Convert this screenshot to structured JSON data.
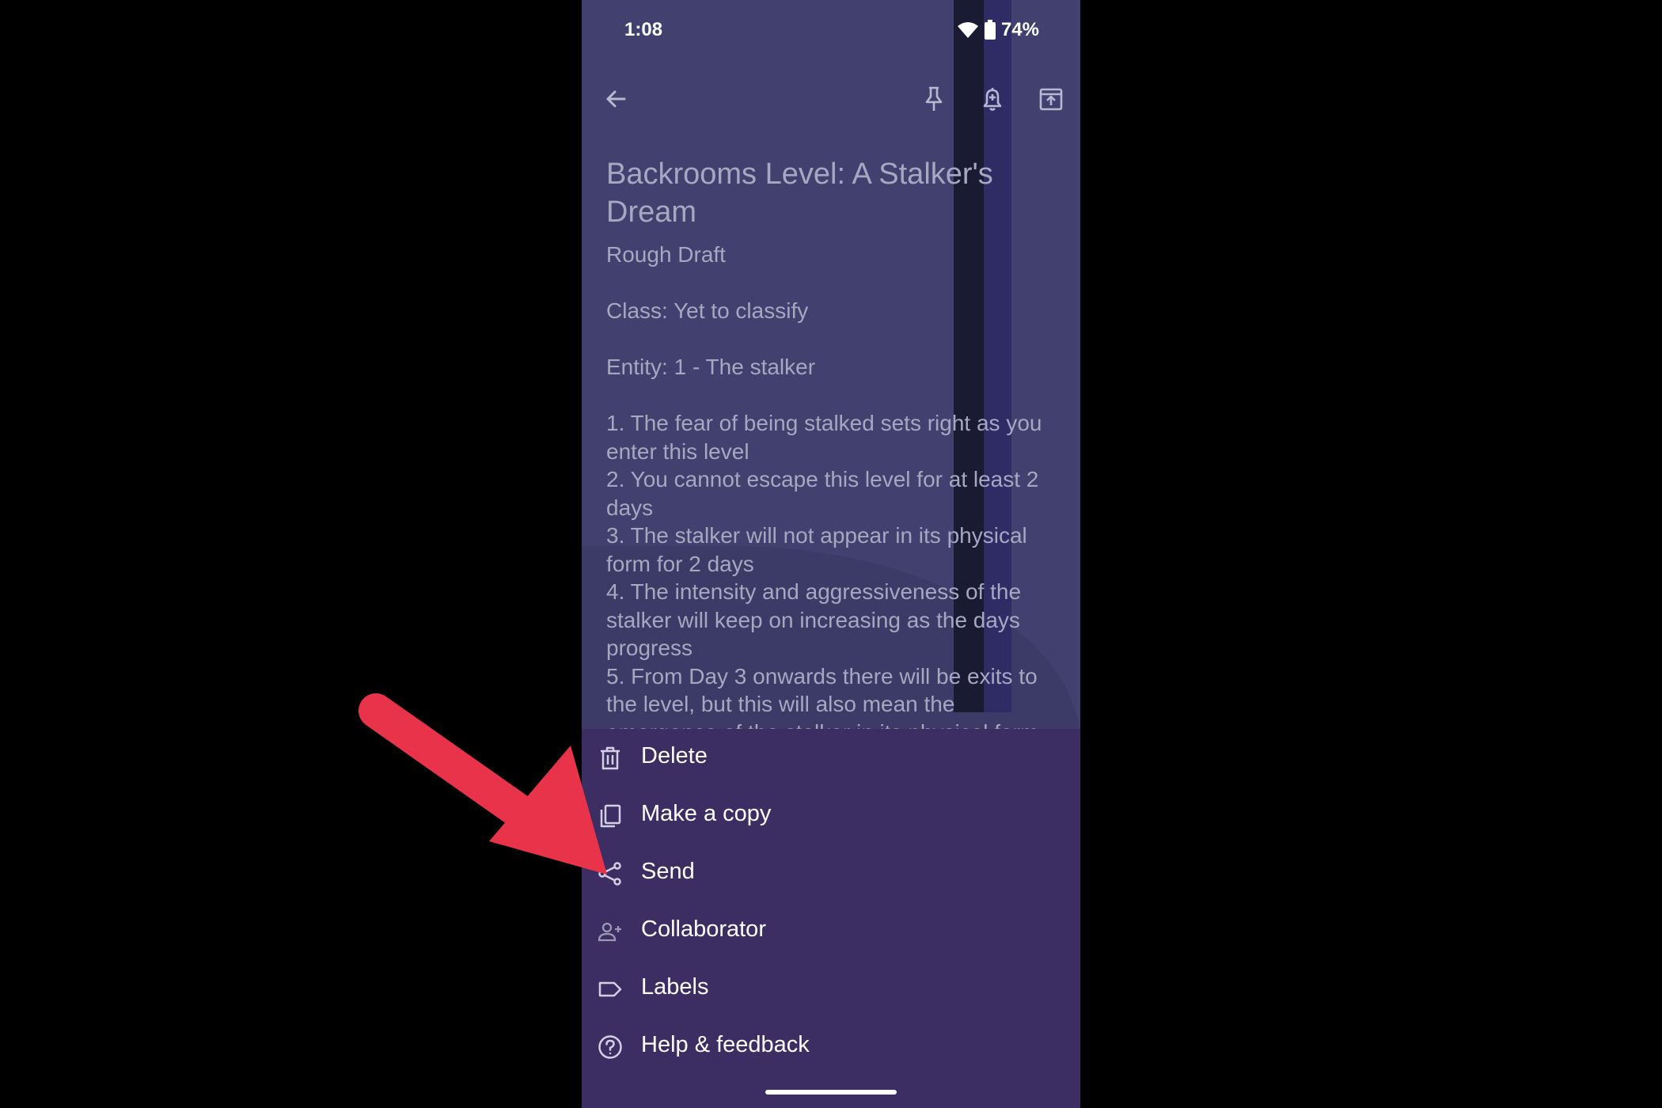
{
  "status_bar": {
    "time": "1:08",
    "battery": "74%"
  },
  "toolbar": {
    "back_icon": "arrow-back-icon",
    "pin_icon": "pin-icon",
    "reminder_icon": "add-alert-icon",
    "archive_icon": "archive-icon"
  },
  "note": {
    "title": "Backrooms Level: A Stalker's Dream",
    "body": "Rough Draft\n\nClass: Yet to classify\n\nEntity: 1 - The stalker\n\n1. The fear of being stalked sets right as you enter this level\n2. You cannot escape this level for at least 2 days\n3. The stalker will not appear in its physical form for 2 days\n4. The intensity and aggressiveness of the stalker will keep on increasing as the days progress\n5. From Day 3 onwards there will be exits to the level, but this will also mean the emergence of the stalker in its physical form"
  },
  "menu": {
    "items": [
      {
        "label": "Delete",
        "icon": "trash-icon"
      },
      {
        "label": "Make a copy",
        "icon": "copy-icon"
      },
      {
        "label": "Send",
        "icon": "share-icon"
      },
      {
        "label": "Collaborator",
        "icon": "add-person-icon"
      },
      {
        "label": "Labels",
        "icon": "label-icon"
      },
      {
        "label": "Help & feedback",
        "icon": "help-icon"
      }
    ]
  },
  "colors": {
    "note_background": "#41406f",
    "menu_background": "#3c2e62",
    "annotation_arrow": "#e8334a"
  }
}
